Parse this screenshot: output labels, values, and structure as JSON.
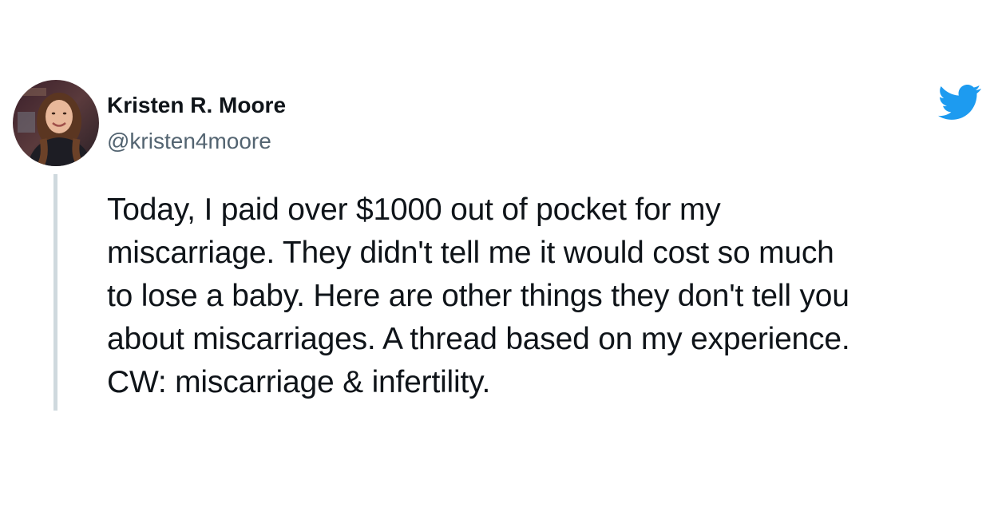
{
  "author": {
    "display_name": "Kristen R. Moore",
    "handle": "@kristen4moore",
    "avatar_icon": "profile-photo"
  },
  "brand": {
    "icon": "twitter-bird-icon",
    "color": "#1d9bf0"
  },
  "tweet": {
    "lines": [
      "Today, I paid over $1000 out of pocket for my",
      "miscarriage. They didn't tell me it would cost so much",
      "to lose a baby. Here are other things they don't tell you",
      "about miscarriages. A thread based on my experience.",
      "CW: miscarriage & infertility."
    ]
  },
  "colors": {
    "text": "#0f1419",
    "secondary_text": "#536471",
    "thread_line": "#cfd9de"
  }
}
